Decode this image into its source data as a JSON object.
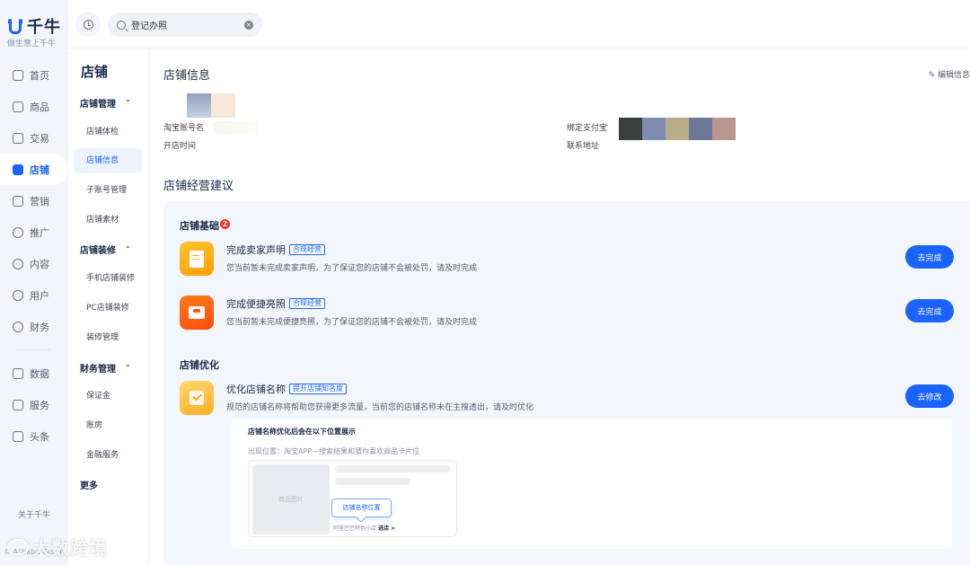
{
  "brand": {
    "name": "千牛",
    "slogan": "做生意上千牛"
  },
  "nav": {
    "items": [
      {
        "label": "首页"
      },
      {
        "label": "商品"
      },
      {
        "label": "交易"
      },
      {
        "label": "店铺"
      },
      {
        "label": "营销"
      },
      {
        "label": "推广"
      },
      {
        "label": "内容"
      },
      {
        "label": "用户"
      },
      {
        "label": "财务"
      },
      {
        "label": "数据"
      },
      {
        "label": "服务"
      },
      {
        "label": "头条"
      }
    ],
    "active": "店铺",
    "about": "关于千牛",
    "copyright": "© Alibaba Group"
  },
  "search": {
    "value": "登记办照"
  },
  "subnav": {
    "title": "店铺",
    "groups": [
      {
        "label": "店铺管理",
        "items": [
          "店铺体检",
          "店铺信息",
          "子账号管理",
          "店铺素材"
        ]
      },
      {
        "label": "店铺装修",
        "items": [
          "手机店铺装修",
          "PC店铺装修",
          "装修管理"
        ]
      },
      {
        "label": "财务管理",
        "items": [
          "保证金",
          "账房",
          "金融服务"
        ]
      }
    ],
    "more": "更多",
    "active": "店铺信息"
  },
  "shop_info": {
    "title": "店铺信息",
    "edit": "编辑信息",
    "labels": {
      "taobao_account": "淘宝账号名",
      "open_time": "开店时间",
      "alipay": "绑定支付宝",
      "address": "联系地址"
    }
  },
  "advice": {
    "title": "店铺经营建议",
    "basic": {
      "title": "店铺基础",
      "badge": "2",
      "tasks": [
        {
          "title": "完成卖家声明",
          "tag": "合规经营",
          "desc": "您当前暂未完成卖家声明，为了保证您的店铺不会被处罚，请及时完成",
          "button": "去完成"
        },
        {
          "title": "完成便捷亮照",
          "tag": "合规经营",
          "desc": "您当前暂未完成便捷亮照，为了保证您的店铺不会被处罚，请及时完成",
          "button": "去完成"
        }
      ]
    },
    "optimize": {
      "title": "店铺优化",
      "tasks": [
        {
          "title": "优化店铺名称",
          "tag": "提升店铺知名度",
          "desc": "规范的店铺名称将帮助您获得更多流量，当前您的店铺名称未在主搜透出，请及时优化",
          "button": "去修改"
        }
      ],
      "preview": {
        "title": "店铺名称优化后会在以下位置展示",
        "location": "出现位置：淘宝APP—搜索结果和猜你喜欢商品卡片位",
        "image_placeholder": "商品图片",
        "position_tag": "店铺名称位置",
        "store_line": "阿里巴巴特色小店",
        "enter": "进店 >"
      }
    }
  },
  "watermark": "大数跨境",
  "colors": {
    "accent": "#1a63ff",
    "badge": "#ff2d2d",
    "task_yellow": "#ffb01a",
    "task_orange": "#ff5a10"
  }
}
